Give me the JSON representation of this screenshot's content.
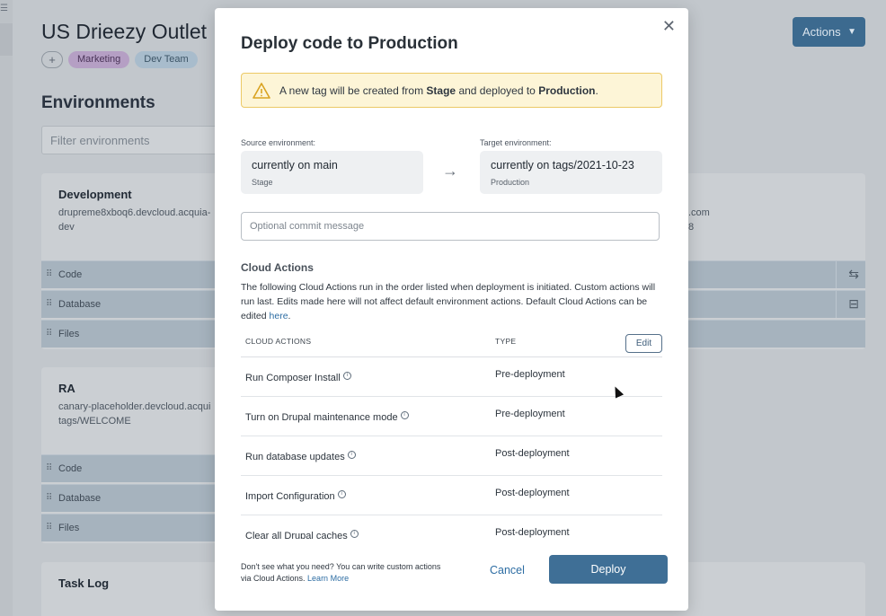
{
  "background": {
    "page_title": "US Drieezy Outlet",
    "tags": [
      "Marketing",
      "Dev Team"
    ],
    "add_tag_symbol": "+",
    "actions_label": "Actions",
    "environments_heading": "Environments",
    "filter_placeholder": "Filter environments",
    "dev_card": {
      "name": "Development",
      "host": "drupreme8xboq6.devcloud.acquia-",
      "branch": "dev",
      "right_host_fragment": ".com",
      "right_fragment": "8",
      "rows": [
        "Code",
        "Database",
        "Files"
      ]
    },
    "ra_card": {
      "name": "RA",
      "host": "canary-placeholder.devcloud.acqui",
      "branch": "tags/WELCOME",
      "rows": [
        "Code",
        "Database",
        "Files"
      ]
    },
    "task_log": {
      "title": "Task Log"
    }
  },
  "modal": {
    "title_prefix": "Deploy code to ",
    "title_target": "Production",
    "warning": {
      "part1": "A new tag will be created from ",
      "source": "Stage",
      "part2": " and deployed to ",
      "target": "Production",
      "part3": "."
    },
    "source_label": "Source environment:",
    "source_main": "currently on main",
    "source_env": "Stage",
    "target_label": "Target environment:",
    "target_main": "currently on tags/2021-10-23",
    "target_env": "Production",
    "commit_placeholder": "Optional commit message",
    "cloud_actions_title": "Cloud Actions",
    "cloud_actions_desc": "The following Cloud Actions run in the order listed when deployment is initiated. Custom actions will run last. Edits made here will not affect default environment actions. Default Cloud Actions can be edited ",
    "cloud_actions_link": "here",
    "table": {
      "col_name": "CLOUD ACTIONS",
      "col_type": "TYPE",
      "edit_label": "Edit",
      "rows": [
        {
          "name": "Run Composer Install",
          "type": "Pre-deployment"
        },
        {
          "name": "Turn on Drupal maintenance mode",
          "type": "Pre-deployment"
        },
        {
          "name": "Run database updates",
          "type": "Post-deployment"
        },
        {
          "name": "Import Configuration",
          "type": "Post-deployment"
        },
        {
          "name": "Clear all Drupal caches",
          "type": "Post-deployment"
        }
      ]
    },
    "footer_note": "Don't see what you need? You can write custom actions via Cloud Actions. ",
    "footer_link": "Learn More",
    "cancel_label": "Cancel",
    "deploy_label": "Deploy"
  },
  "colors": {
    "primary": "#3f6f96",
    "link": "#2d6da3",
    "warning_bg": "#fdf5d7",
    "warning_border": "#ecc966"
  }
}
